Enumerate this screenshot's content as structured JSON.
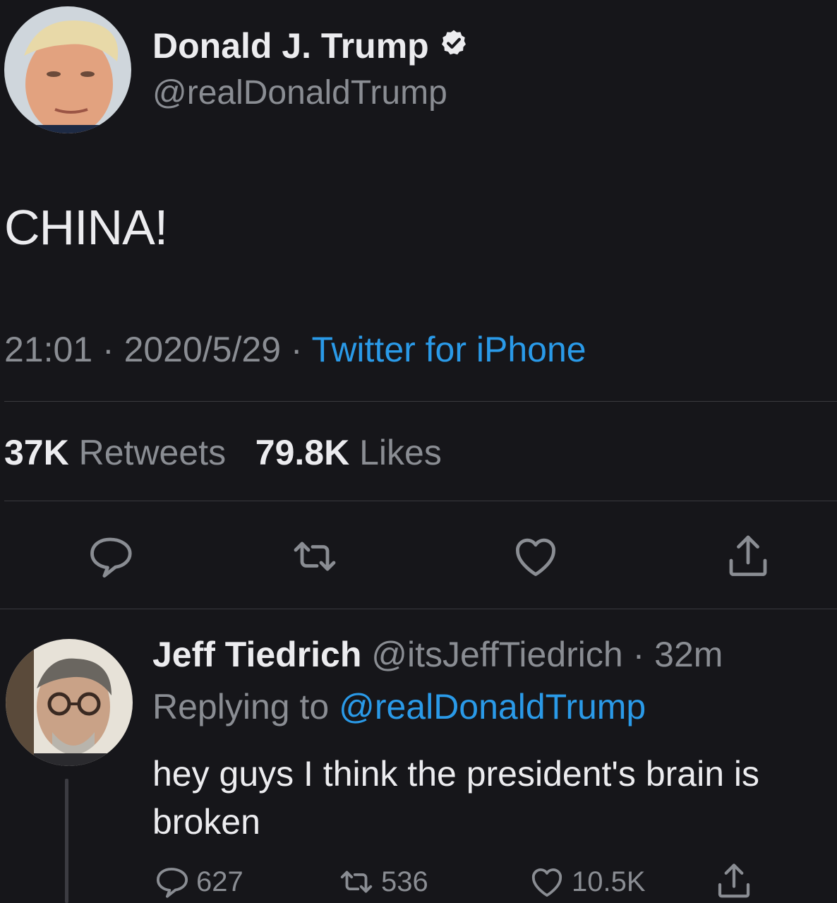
{
  "tweet": {
    "author_name": "Donald J. Trump",
    "author_handle": "@realDonaldTrump",
    "text": "CHINA!",
    "time": "21:01",
    "date": "2020/5/29",
    "separator": " · ",
    "source": "Twitter for iPhone",
    "retweets_count": "37K",
    "retweets_label": "Retweets",
    "likes_count": "79.8K",
    "likes_label": "Likes",
    "icons": [
      "verified-badge-icon",
      "reply-icon",
      "retweet-icon",
      "like-icon",
      "share-icon"
    ]
  },
  "reply": {
    "author_name": "Jeff Tiedrich",
    "author_handle": "@itsJeffTiedrich",
    "age": "32m",
    "replying_to_label": "Replying to",
    "replying_to_handle": "@realDonaldTrump",
    "text": "hey guys I think the president's brain is broken",
    "reply_count": "627",
    "retweet_count": "536",
    "like_count": "10.5K"
  },
  "colors": {
    "background": "#16161a",
    "text": "#ececef",
    "muted": "#8a8d93",
    "link": "#2a9ae8",
    "divider": "#3a3a3f"
  }
}
